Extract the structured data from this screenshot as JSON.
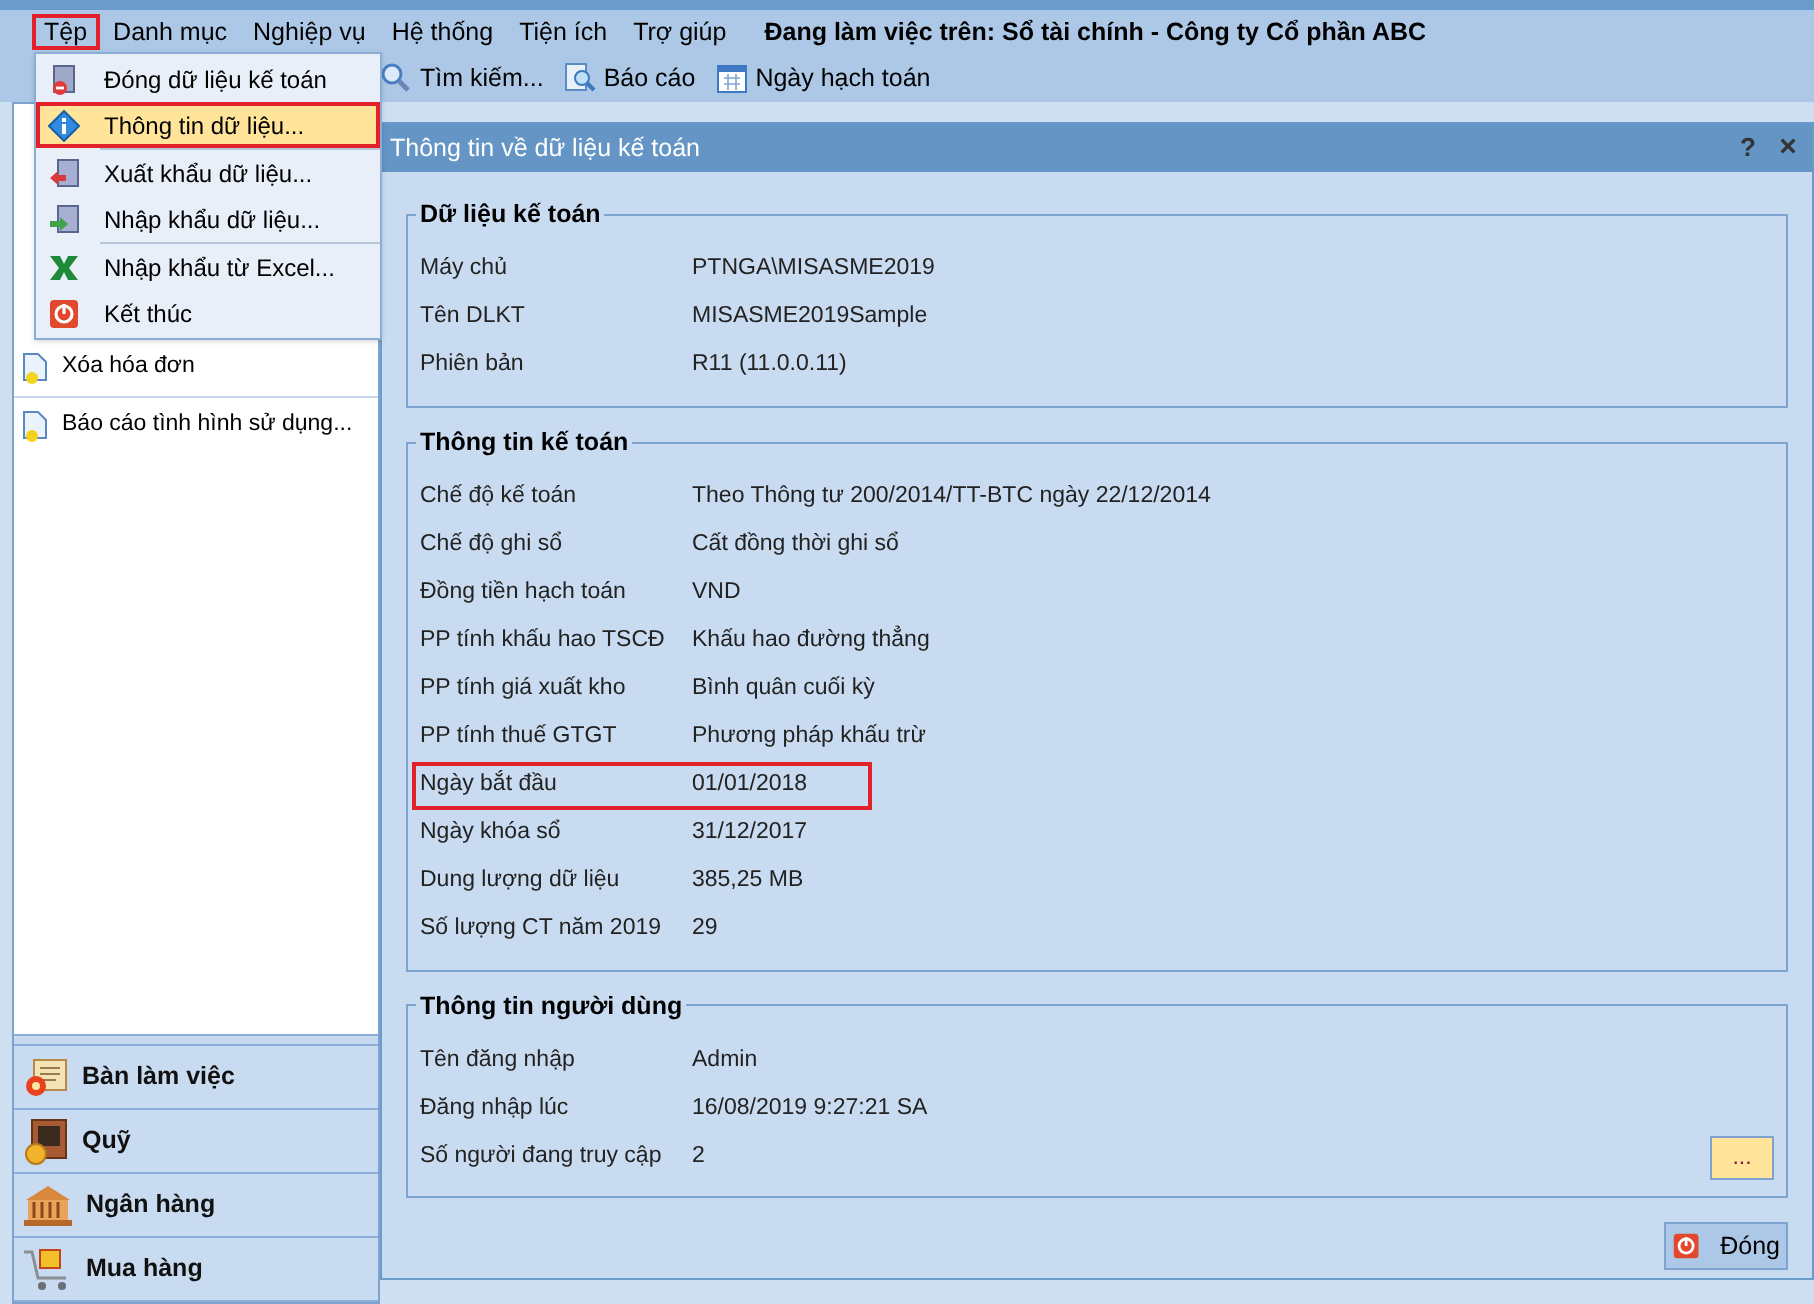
{
  "window_title": "Đang làm việc trên: Sổ tài chính - Công ty Cổ phần ABC",
  "menu_bar": [
    {
      "label": "Tệp",
      "highlighted": true
    },
    {
      "label": "Danh mục",
      "highlighted": false
    },
    {
      "label": "Nghiệp vụ",
      "highlighted": false
    },
    {
      "label": "Hệ thống",
      "highlighted": false
    },
    {
      "label": "Tiện ích",
      "highlighted": false
    },
    {
      "label": "Trợ giúp",
      "highlighted": false
    }
  ],
  "toolbar": [
    {
      "label": "Tìm kiếm...",
      "kind": "search"
    },
    {
      "label": "Báo cáo",
      "kind": "report"
    },
    {
      "label": "Ngày hạch toán",
      "kind": "calendar"
    }
  ],
  "file_menu": {
    "groups": [
      [
        {
          "label": "Đóng dữ liệu kế toán",
          "kind": "database",
          "highlighted": false
        },
        {
          "label": "Thông tin dữ liệu...",
          "kind": "info",
          "highlighted": true
        }
      ],
      [
        {
          "label": "Xuất khẩu dữ liệu...",
          "kind": "export",
          "highlighted": false
        },
        {
          "label": "Nhập khẩu dữ liệu...",
          "kind": "import",
          "highlighted": false
        }
      ],
      [
        {
          "label": "Nhập khẩu từ Excel...",
          "kind": "excel",
          "highlighted": false
        },
        {
          "label": "Kết thúc",
          "kind": "power",
          "highlighted": false
        }
      ]
    ]
  },
  "sidebar": {
    "items": [
      {
        "label": "Xóa hóa đơn"
      },
      {
        "label": "Báo cáo tình hình sử dụng..."
      }
    ],
    "nav": [
      {
        "label": "Bàn làm việc",
        "kind": "desk"
      },
      {
        "label": "Quỹ",
        "kind": "safe"
      },
      {
        "label": "Ngân hàng",
        "kind": "bank"
      },
      {
        "label": "Mua hàng",
        "kind": "cart"
      }
    ]
  },
  "dialog": {
    "title": "Thông tin về dữ liệu kế toán",
    "help": "?",
    "close": "×",
    "groups": [
      {
        "title": "Dữ liệu kế toán",
        "rows": [
          {
            "label": "Máy chủ",
            "value": "PTNGA\\MISASME2019",
            "highlighted": false
          },
          {
            "label": "Tên DLKT",
            "value": "MISASME2019Sample",
            "highlighted": false
          },
          {
            "label": "Phiên bản",
            "value": "R11 (11.0.0.11)",
            "highlighted": false
          }
        ]
      },
      {
        "title": "Thông tin kế toán",
        "rows": [
          {
            "label": "Chế độ kế toán",
            "value": "Theo Thông tư 200/2014/TT-BTC ngày 22/12/2014",
            "highlighted": false
          },
          {
            "label": "Chế độ ghi sổ",
            "value": "Cất đồng thời ghi sổ",
            "highlighted": false
          },
          {
            "label": "Đồng tiền hạch toán",
            "value": "VND",
            "highlighted": false
          },
          {
            "label": "PP tính khấu hao TSCĐ",
            "value": "Khấu hao đường thẳng",
            "highlighted": false
          },
          {
            "label": "PP tính giá xuất kho",
            "value": "Bình quân cuối kỳ",
            "highlighted": false
          },
          {
            "label": "PP tính thuế GTGT",
            "value": "Phương pháp khấu trừ",
            "highlighted": false
          },
          {
            "label": "Ngày bắt đầu",
            "value": "01/01/2018",
            "highlighted": true
          },
          {
            "label": "Ngày khóa sổ",
            "value": "31/12/2017",
            "highlighted": false
          },
          {
            "label": "Dung lượng dữ liệu",
            "value": "385,25 MB",
            "highlighted": false
          },
          {
            "label": "Số lượng CT năm 2019",
            "value": "29",
            "highlighted": false
          }
        ]
      },
      {
        "title": "Thông tin người dùng",
        "rows": [
          {
            "label": "Tên đăng nhập",
            "value": "Admin",
            "highlighted": false
          },
          {
            "label": "Đăng nhập lúc",
            "value": "16/08/2019 9:27:21 SA",
            "highlighted": false
          },
          {
            "label": "Số người đang truy cập",
            "value": "2",
            "highlighted": false
          }
        ],
        "button": "..."
      }
    ],
    "close_button": "Đóng"
  }
}
